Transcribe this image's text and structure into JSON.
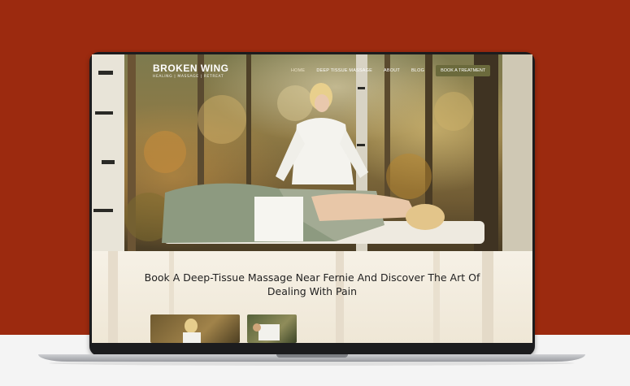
{
  "site": {
    "logo_title": "BROKEN WING",
    "logo_subtitle": "HEALING | MASSAGE | RETREAT"
  },
  "nav": {
    "items": [
      {
        "label": "HOME",
        "active": true
      },
      {
        "label": "DEEP TISSUE MASSAGE",
        "active": false
      },
      {
        "label": "ABOUT",
        "active": false
      },
      {
        "label": "BLOG",
        "active": false
      }
    ],
    "cta_label": "BOOK A TREATMENT"
  },
  "hero": {
    "headline": "Book A Deep-Tissue Massage Near Fernie And Discover The Art Of Dealing With Pain"
  },
  "colors": {
    "background": "#9c2a0f",
    "cta": "#6b6a3c",
    "content_band": "#f3ede2"
  }
}
